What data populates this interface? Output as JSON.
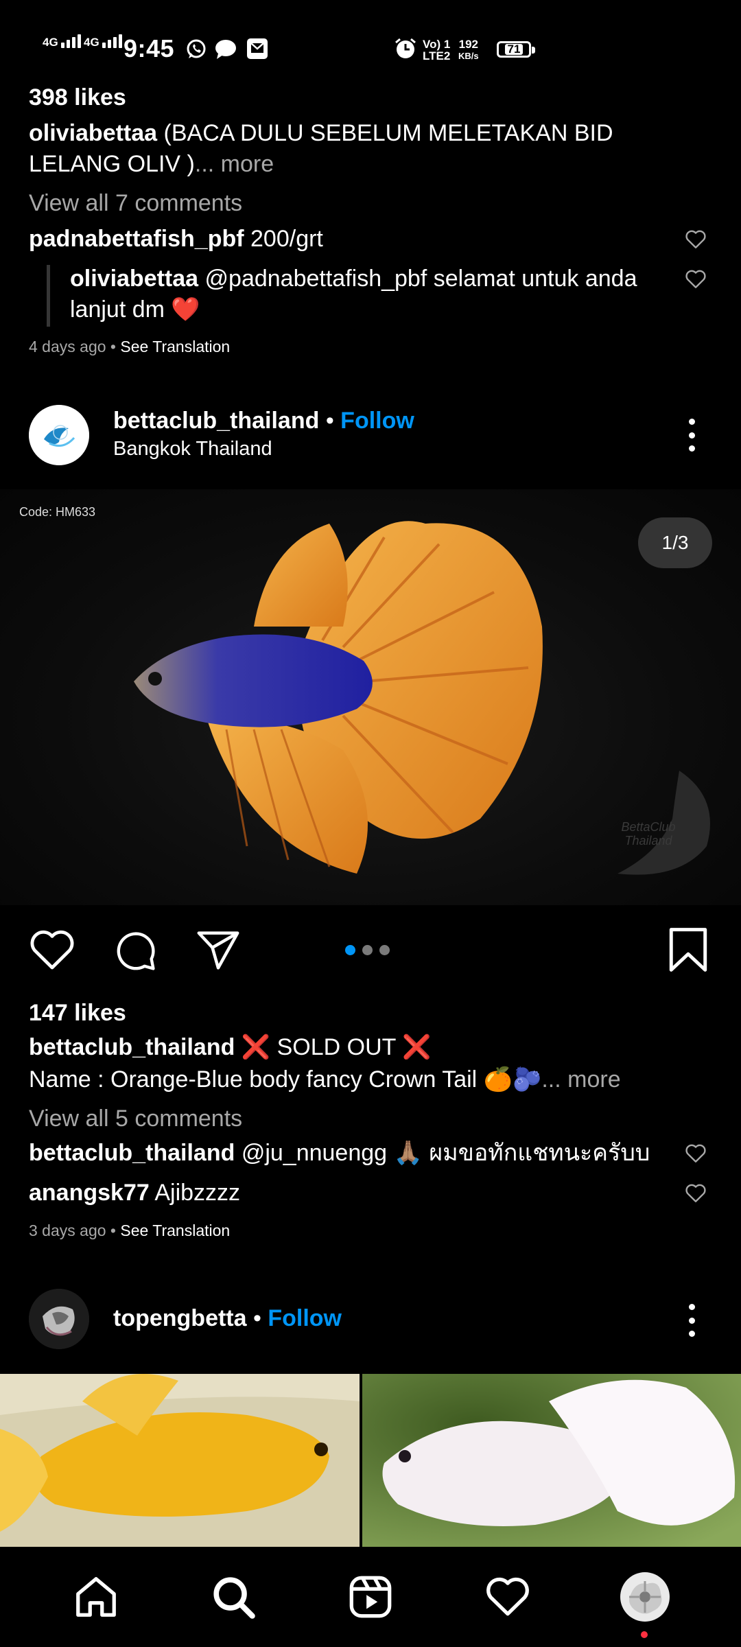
{
  "status_bar": {
    "net1": "4G",
    "net2": "4G",
    "time": "9:45",
    "volte_top": "Vo) 1",
    "volte_bottom": "LTE2",
    "speed_top": "192",
    "speed_bottom": "KB/s",
    "battery": "71"
  },
  "post1": {
    "likes": "398 likes",
    "caption_user": "oliviabettaa",
    "caption_text": " (BACA DULU SEBELUM MELETAKAN BID LELANG OLIV )",
    "more": "... more",
    "view_comments": "View all 7 comments",
    "comment1_user": "padnabettafish_pbf",
    "comment1_text": " 200/grt",
    "reply_user": "oliviabettaa",
    "reply_text": " @padnabettafish_pbf selamat untuk anda lanjut dm ❤️",
    "time": "4 days ago",
    "see_translation": "See Translation"
  },
  "post2": {
    "username": "bettaclub_thailand",
    "follow": "Follow",
    "location": "Bangkok Thailand",
    "image_code": "Code: HM633",
    "counter": "1/3",
    "watermark": "BettaClub Thailand",
    "likes": "147 likes",
    "caption_user": "bettaclub_thailand",
    "caption_line1": " ❌ SOLD OUT ❌",
    "caption_line2": "Name : Orange-Blue body fancy Crown Tail 🍊🫐",
    "more": "... more",
    "view_comments": "View all 5 comments",
    "comment1_user": "bettaclub_thailand",
    "comment1_text": " @ju_nnuengg 🙏🏽 ผมขอทักแชทนะครับบ",
    "comment2_user": "anangsk77",
    "comment2_text": " Ajibzzzz",
    "time": "3 days ago",
    "see_translation": "See Translation",
    "carousel_active": 1,
    "carousel_total": 3
  },
  "post3": {
    "username": "topengbetta",
    "follow": "Follow"
  },
  "colors": {
    "accent": "#0095f6",
    "background": "#000000",
    "secondary_text": "#a8a8a8",
    "notification_dot": "#ff3040"
  },
  "nav": {
    "items": [
      "home-icon",
      "search-icon",
      "reels-icon",
      "activity-heart-icon",
      "profile-avatar"
    ]
  }
}
